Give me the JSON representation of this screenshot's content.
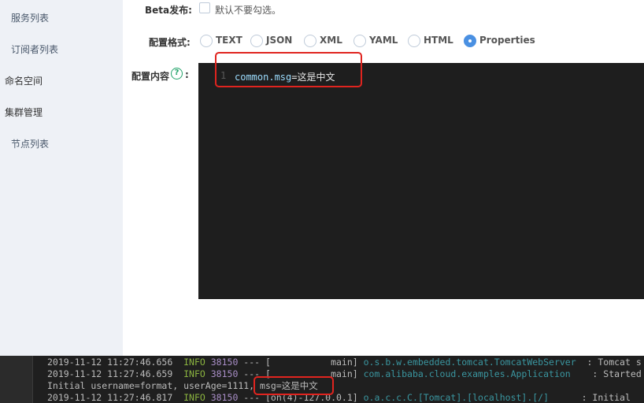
{
  "sidebar": {
    "items": [
      {
        "label": "服务列表"
      },
      {
        "label": "订阅者列表"
      },
      {
        "label": "命名空间"
      },
      {
        "label": "集群管理"
      },
      {
        "label": "节点列表"
      }
    ]
  },
  "form": {
    "beta_label": "Beta发布:",
    "beta_checkbox_text": "默认不要勾选。",
    "format_label": "配置格式:",
    "formats": [
      {
        "label": "TEXT",
        "checked": false
      },
      {
        "label": "JSON",
        "checked": false
      },
      {
        "label": "XML",
        "checked": false
      },
      {
        "label": "YAML",
        "checked": false
      },
      {
        "label": "HTML",
        "checked": false
      },
      {
        "label": "Properties",
        "checked": true
      }
    ],
    "content_label": "配置内容",
    "help_icon": "question-circle-icon",
    "help_glyph": "?",
    "colon": ":"
  },
  "editor": {
    "line_number": "1",
    "code_key": "common.msg",
    "code_value": "=这是中文"
  },
  "terminal": {
    "lines": [
      {
        "ts": "2019-11-12 11:27:46.656",
        "level": "INFO",
        "pid": "38150",
        "sep": " --- [",
        "thread": "           main]",
        "logger": " o.s.b.w.embedded.tomcat.TomcatWebServer",
        "msg": "  : Tomcat s"
      },
      {
        "ts": "2019-11-12 11:27:46.659",
        "level": "INFO",
        "pid": "38150",
        "sep": " --- [",
        "thread": "           main]",
        "logger": " com.alibaba.cloud.examples.Application",
        "msg": "    : Started"
      },
      {
        "plain": "Initial username=format, userAge=1111, ",
        "msg_highlight": "msg=这是中文"
      },
      {
        "ts": "2019-11-12 11:27:46.817",
        "level": "INFO",
        "pid": "38150",
        "sep": " --- [",
        "thread": "on(4)-127.0.0.1]",
        "logger": " o.a.c.c.C.[Tomcat].[localhost].[/]",
        "msg": "      : Initial"
      }
    ]
  },
  "colors": {
    "accent": "#4a90e2",
    "annotation": "#e0241f",
    "sidebar_bg": "#eef1f6",
    "editor_bg": "#1e1e1e",
    "help_icon": "#22a36a"
  }
}
